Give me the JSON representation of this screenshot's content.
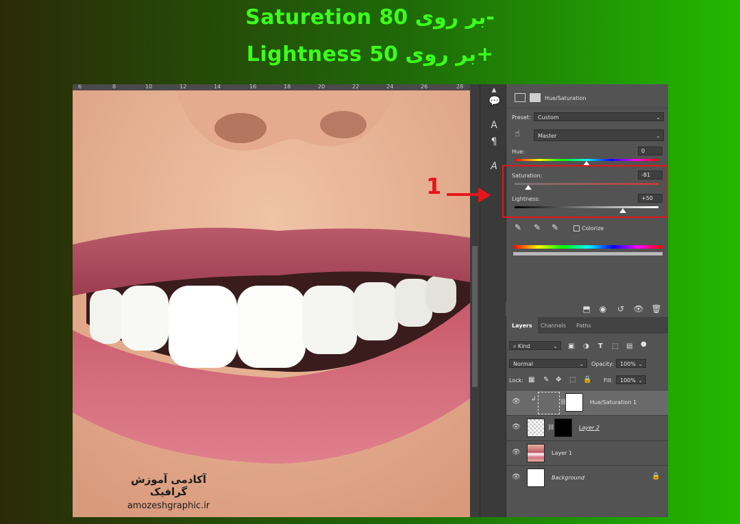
{
  "headline": {
    "line1": "Saturetion بر روی 80-",
    "line2": "Lightness بر روی  50+"
  },
  "annotation": {
    "number": "1",
    "highlight_color": "#e8141c"
  },
  "canvas": {
    "ruler_ticks": [
      "6",
      "8",
      "10",
      "12",
      "14",
      "16",
      "18",
      "20",
      "22",
      "24",
      "26",
      "28"
    ],
    "watermark_fa": "آکادمی آموزش گرافیک",
    "watermark_url": "amozeshgraphic.ir"
  },
  "properties": {
    "panel_title": "Hue/Saturation",
    "preset_label": "Preset:",
    "preset_value": "Custom",
    "channel_value": "Master",
    "hue": {
      "label": "Hue:",
      "value": "0",
      "level": 0.5
    },
    "saturation": {
      "label": "Saturation:",
      "value": "-81",
      "level": 0.095
    },
    "lightness": {
      "label": "Lightness:",
      "value": "+50",
      "level": 0.75
    },
    "colorize_label": "Colorize"
  },
  "layers_panel": {
    "tabs": [
      "Layers",
      "Channels",
      "Paths"
    ],
    "filter_label": "Kind",
    "blend_mode": "Normal",
    "opacity_label": "Opacity:",
    "opacity_value": "100%",
    "lock_label": "Lock:",
    "fill_label": "Fill:",
    "fill_value": "100%",
    "layers": [
      {
        "name": "Hue/Saturation 1"
      },
      {
        "name": "Layer 2"
      },
      {
        "name": "Layer 1"
      },
      {
        "name": "Background"
      }
    ]
  },
  "colors": {
    "headline": "#3cff1a",
    "panel_bg": "#535353",
    "panel_dark": "#3f3f3f"
  }
}
